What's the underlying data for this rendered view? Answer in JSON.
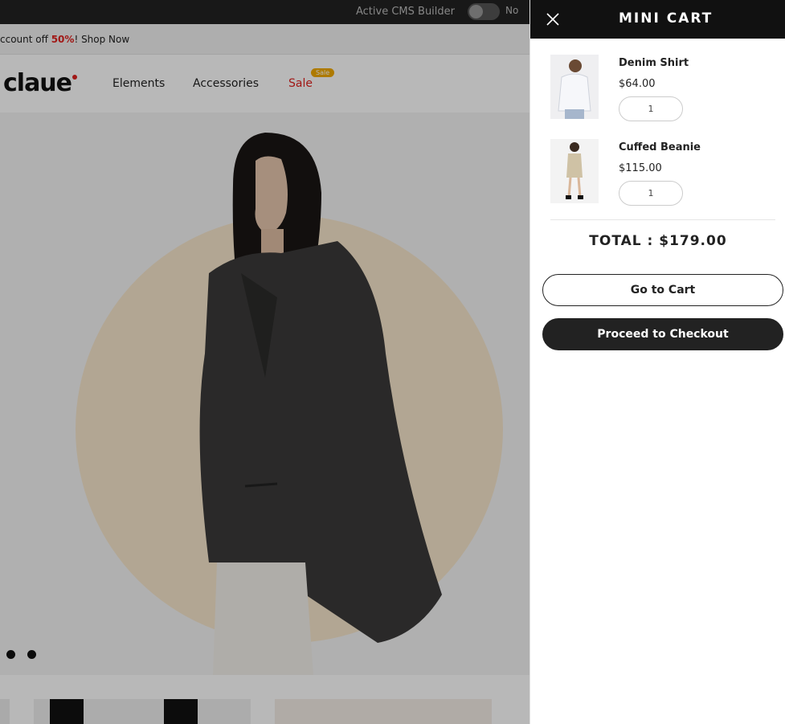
{
  "topbar": {
    "cms_label": "Active CMS Builder",
    "toggle_state": "No"
  },
  "promo": {
    "prefix": "ccount off ",
    "highlight": "50%",
    "suffix": "! Shop Now"
  },
  "header": {
    "logo": "claue",
    "nav": {
      "elements": "Elements",
      "accessories": "Accessories",
      "sale": "Sale",
      "sale_badge": "Sale"
    }
  },
  "cart": {
    "title": "MINI CART",
    "items": [
      {
        "name": "Denim Shirt",
        "price": "$64.00",
        "qty": "1"
      },
      {
        "name": "Cuffed Beanie",
        "price": "$115.00",
        "qty": "1"
      }
    ],
    "total": "TOTAL : $179.00",
    "go_to_cart": "Go to Cart",
    "checkout": "Proceed to Checkout"
  },
  "colors": {
    "accent_red": "#e0221f",
    "sale_badge": "#f2a900",
    "dark": "#111111"
  }
}
